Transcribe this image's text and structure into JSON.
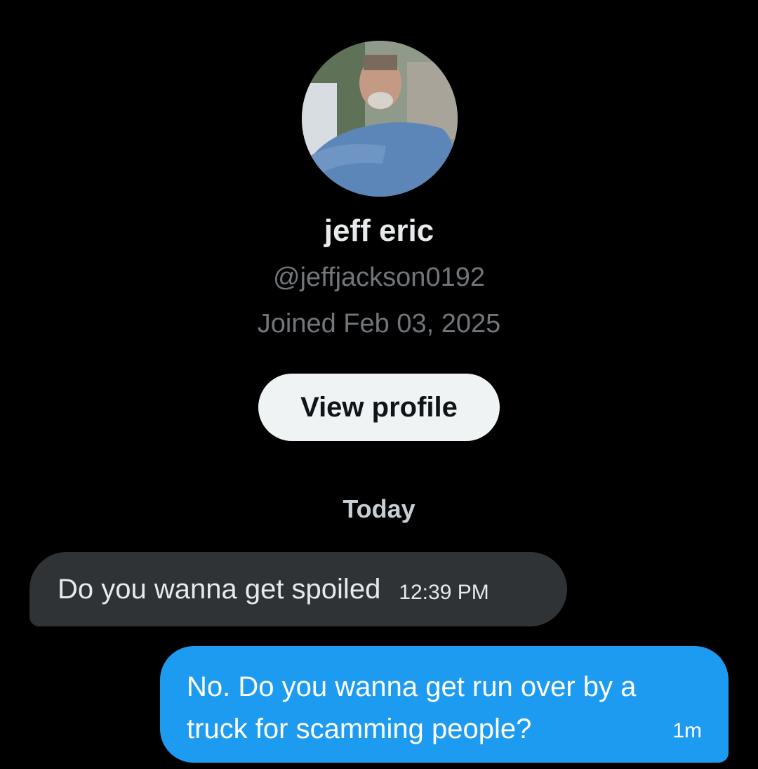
{
  "profile": {
    "display_name": "jeff eric",
    "handle": "@jeffjackson0192",
    "joined": "Joined Feb 03, 2025",
    "view_profile_label": "View profile"
  },
  "conversation": {
    "date_separator": "Today",
    "messages": [
      {
        "direction": "incoming",
        "text": "Do you wanna get spoiled",
        "time": "12:39 PM"
      },
      {
        "direction": "outgoing",
        "text": "No. Do you wanna get run over by a truck for scamming people?",
        "time": "1m"
      }
    ]
  },
  "colors": {
    "background": "#000000",
    "incoming_bubble": "#2f3336",
    "outgoing_bubble": "#1d9bf0",
    "muted_text": "#71767b",
    "button_bg": "#eff3f4"
  }
}
